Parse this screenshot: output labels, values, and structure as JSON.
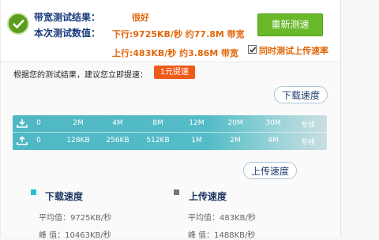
{
  "result": {
    "bandwidth_label": "带宽测试结果：",
    "bandwidth_value": "很好",
    "values_label": "本次测试数值：",
    "download_value": "下行:9725KB/秒  约77.8M 带宽",
    "upload_value": "上行:483KB/秒  约3.86M 带宽"
  },
  "retest_label": "重新测速",
  "upload_checkbox_label": "同时测试上传速率",
  "upload_checkbox_checked": true,
  "advice": "根据您的测试结果，建议您立即提速：",
  "boost_label": "1元提速",
  "bubble_download": "下载速度",
  "bubble_upload": "上传速度",
  "scale": {
    "download_ticks": [
      "0",
      "2M",
      "4M",
      "8M",
      "12M",
      "20M",
      "30M",
      "专线"
    ],
    "upload_ticks": [
      "0",
      "128KB",
      "256KB",
      "512KB",
      "1M",
      "2M",
      "4M",
      "专线"
    ]
  },
  "legend": {
    "download_title": "下载速度",
    "upload_title": "上传速度",
    "download_avg": "平均值：9725KB/秒",
    "download_peak": "峰  值：10463KB/秒",
    "upload_avg": "平均值：483KB/秒",
    "upload_peak": "峰  值：1488KB/秒"
  },
  "colors": {
    "accent_green": "#68b82a",
    "value_orange": "#e2660a",
    "scale_teal": "#4fb8c4",
    "boost_orange": "#ee5b18"
  }
}
